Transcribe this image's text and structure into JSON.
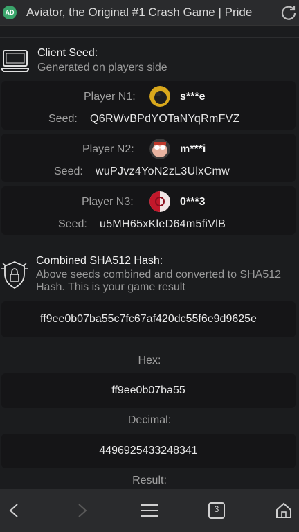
{
  "browser": {
    "site_badge": "AD",
    "page_title": "Aviator, the Original #1 Crash Game | Pride",
    "tab_count": "3"
  },
  "client_seed": {
    "title": "Client Seed:",
    "subtitle": "Generated on players side"
  },
  "players": [
    {
      "label": "Player N1:",
      "name": "s***e",
      "seed_label": "Seed:",
      "seed": "Q6RWvBPdYOTaNYqRmFVZ"
    },
    {
      "label": "Player N2:",
      "name": "m***i",
      "seed_label": "Seed:",
      "seed": "wuPJvz4YoN2zL3UlxCmw"
    },
    {
      "label": "Player N3:",
      "name": "0***3",
      "seed_label": "Seed:",
      "seed": "u5MH65xKleD64m5fiVlB"
    }
  ],
  "hash": {
    "title": "Combined SHA512 Hash:",
    "subtitle": "Above seeds combined and converted to SHA512 Hash. This is your game result",
    "value": "ff9ee0b07ba55c7fc67af420dc55f6e9d9625e"
  },
  "hex": {
    "label": "Hex:",
    "value": "ff9ee0b07ba55"
  },
  "decimal": {
    "label": "Decimal:",
    "value": "4496925433248341"
  },
  "result": {
    "label": "Result:"
  }
}
